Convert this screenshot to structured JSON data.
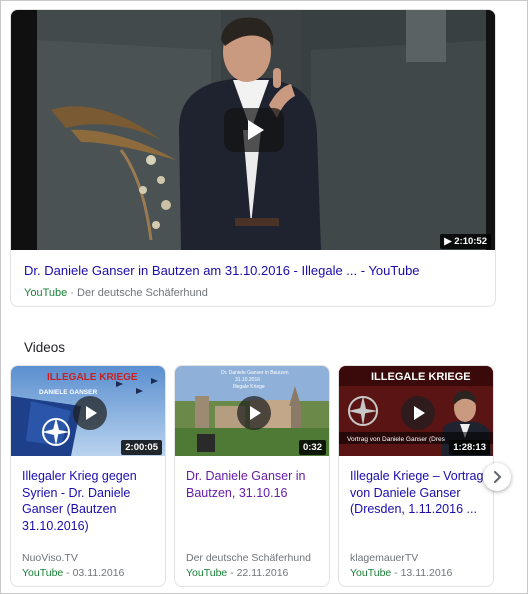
{
  "featured": {
    "title": "Dr. Daniele Ganser in Bautzen am 31.10.2016 - Illegale ... - YouTube",
    "source": "YouTube",
    "separator": " · ",
    "channel": "Der deutsche Schäferhund",
    "duration": "▶ 2:10:52",
    "play_icon": "play-icon"
  },
  "videos_section": {
    "heading": "Videos",
    "items": [
      {
        "title": "Illegaler Krieg gegen Syrien - Dr. Daniele Ganser (Bautzen 31.10.2016)",
        "duration": "2:00:05",
        "thumb_text": "ILLEGALE KRIEGE",
        "thumb_sub": "DANIELE GANSER",
        "channel": "NuoViso.TV",
        "platform": "YouTube",
        "date": " - 03.11.2016"
      },
      {
        "title": "Dr. Daniele Ganser in Bautzen, 31.10.16",
        "duration": "0:32",
        "thumb_text": "Dr. Daniele Ganser in Bautzen",
        "thumb_sub": "31.10.2016",
        "thumb_sub2": "Illegale Kriege",
        "channel": "Der deutsche Schäferhund",
        "platform": "YouTube",
        "date": " - 22.11.2016"
      },
      {
        "title": "Illegale Kriege – Vortrag von Daniele Ganser (Dresden, 1.11.2016 ...",
        "duration": "1:28:13",
        "thumb_text": "ILLEGALE KRIEGE",
        "thumb_sub": "Vortrag von Daniele Ganser (Dres",
        "channel": "klagemauerTV",
        "platform": "YouTube",
        "date": " - 13.11.2016"
      }
    ],
    "next_icon": "chevron-right-icon"
  },
  "colors": {
    "link": "#1a0dab",
    "visited": "#681da8",
    "source_green": "#188038",
    "meta_gray": "#70757a"
  }
}
